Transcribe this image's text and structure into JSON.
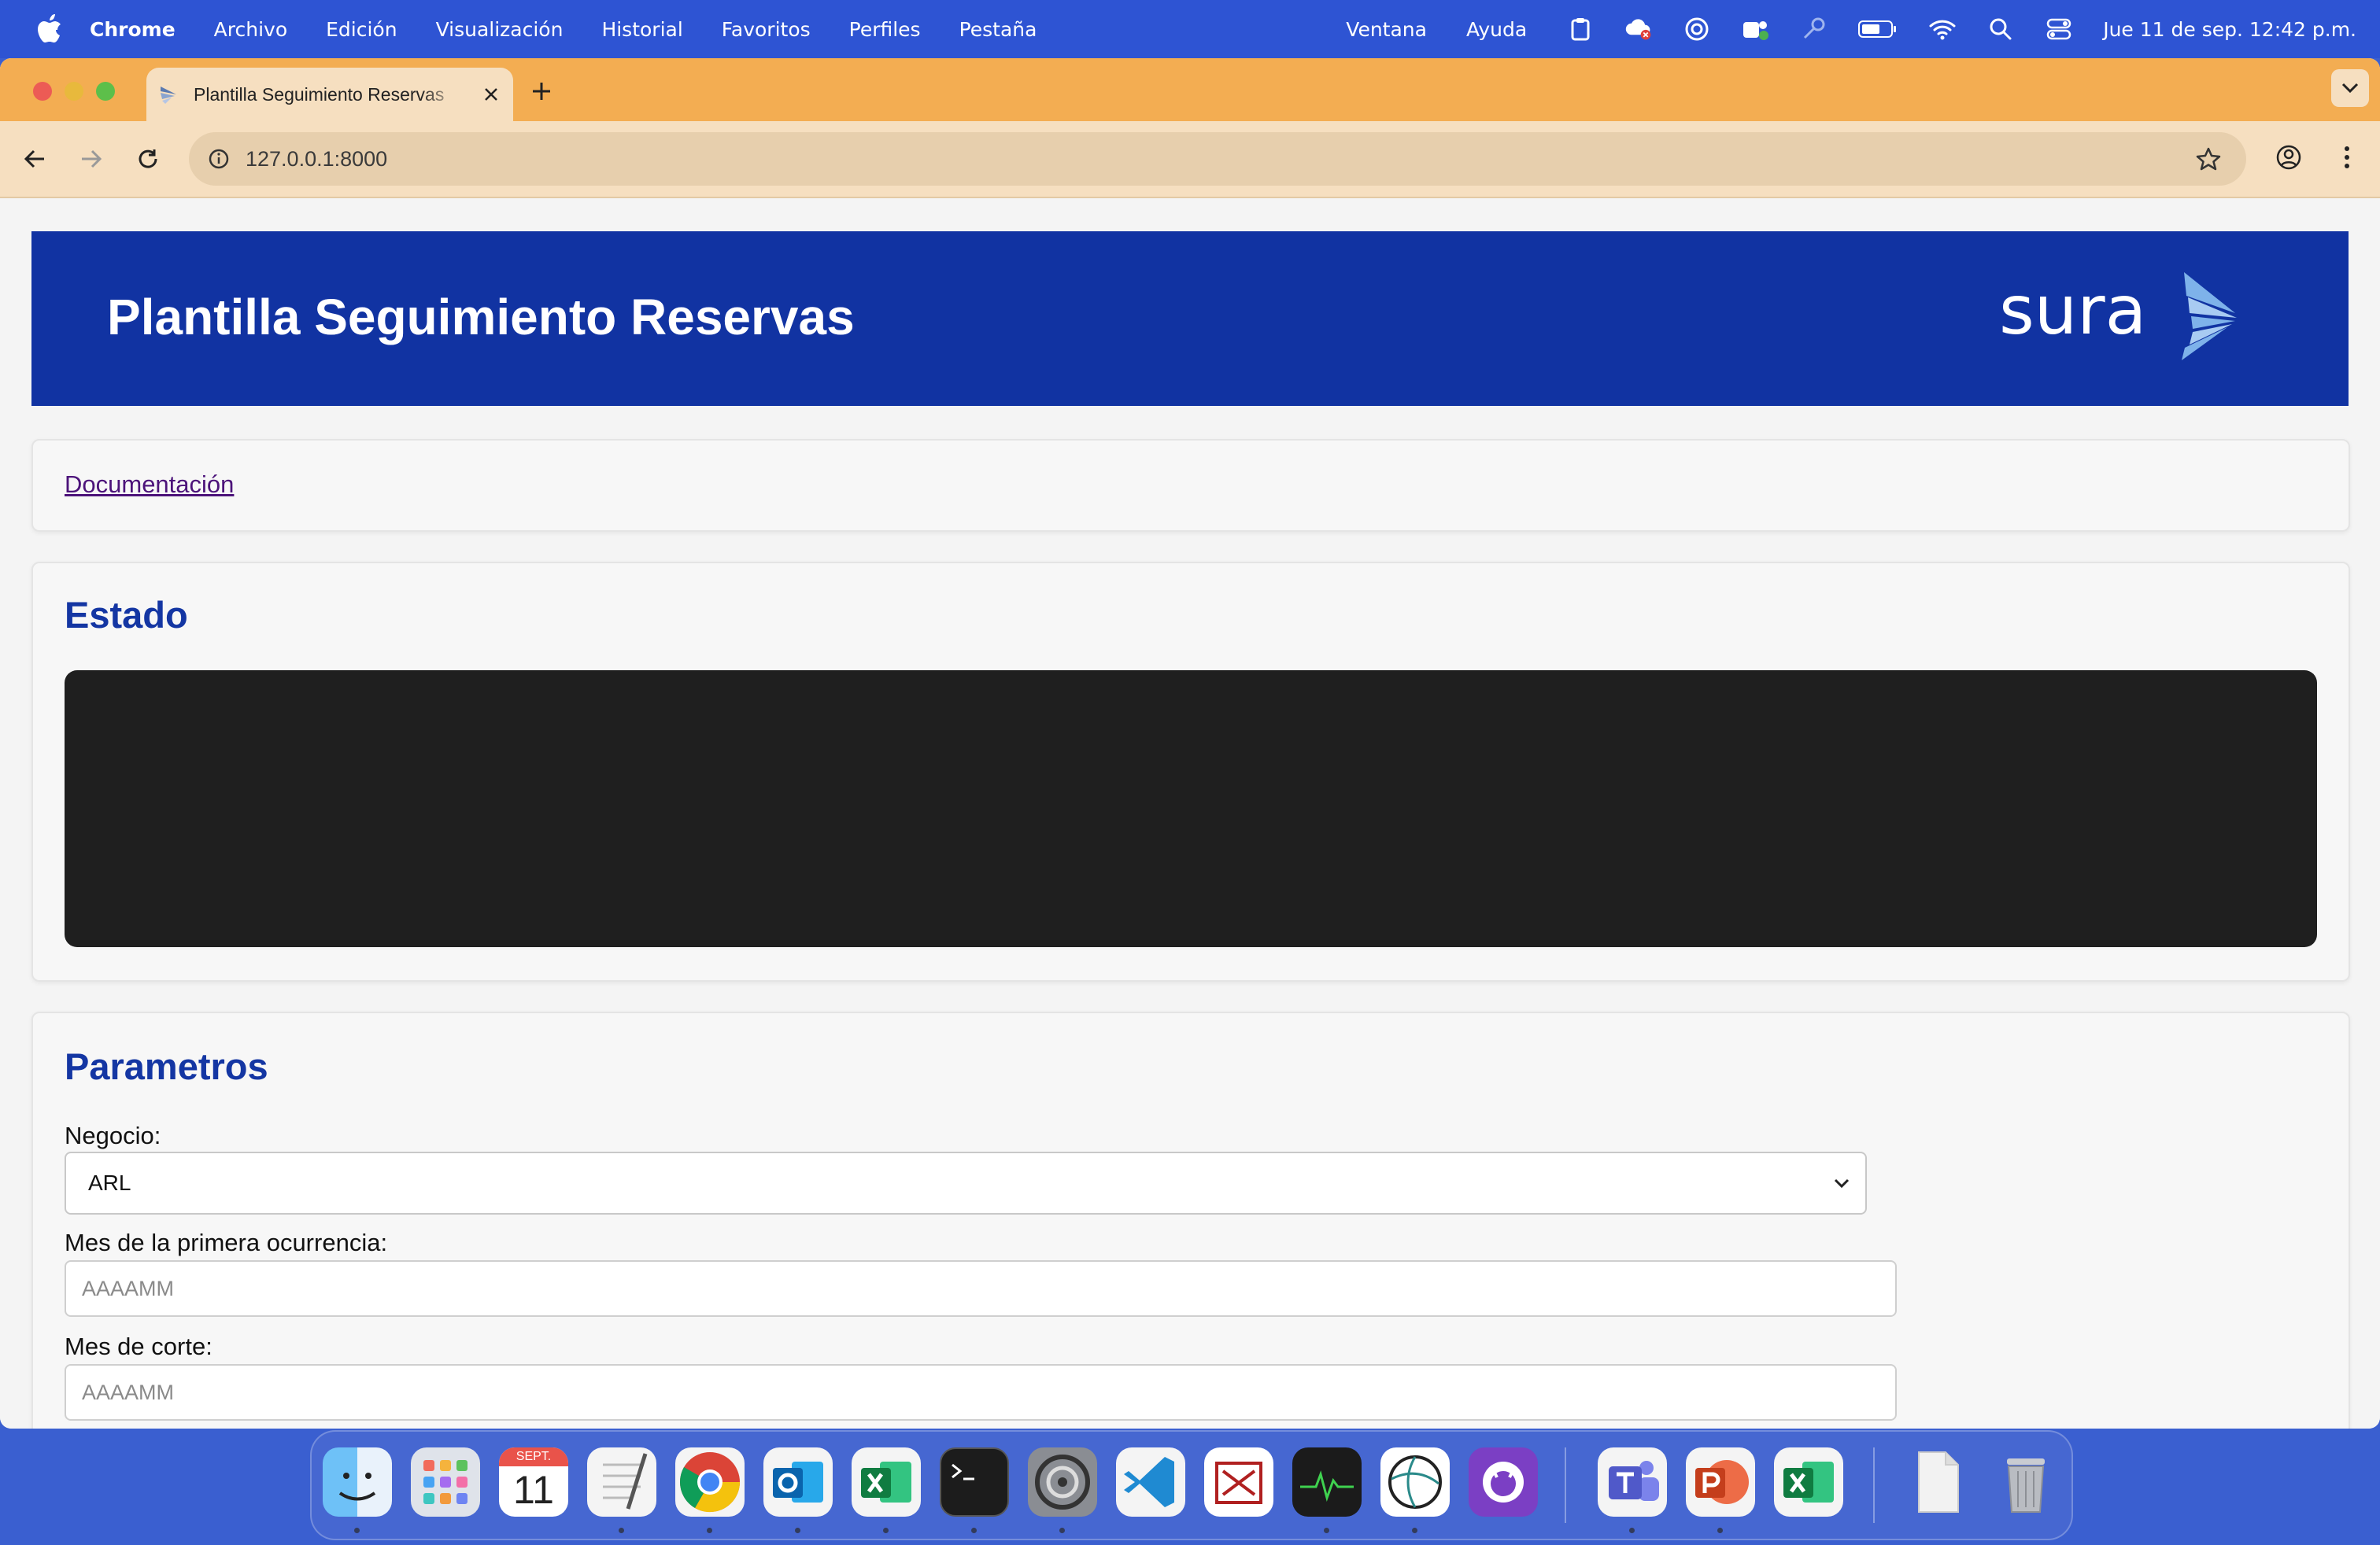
{
  "menubar": {
    "app": "Chrome",
    "items": [
      "Archivo",
      "Edición",
      "Visualización",
      "Historial",
      "Favoritos",
      "Perfiles",
      "Pestaña"
    ],
    "right_items": [
      "Ventana",
      "Ayuda"
    ],
    "clock": "Jue 11 de sep.  12:42 p.m."
  },
  "browser": {
    "tab_title": "Plantilla Seguimiento Reservas",
    "url": "127.0.0.1:8000"
  },
  "page": {
    "banner_title": "Plantilla Seguimiento Reservas",
    "logo_text": "sura",
    "doc_link": "Documentación",
    "estado_title": "Estado",
    "params_title": "Parametros",
    "negocio_label": "Negocio:",
    "negocio_value": "ARL",
    "mes_ocurrencia_label": "Mes de la primera ocurrencia:",
    "mes_ocurrencia_placeholder": "AAAAMM",
    "mes_corte_label": "Mes de corte:",
    "mes_corte_placeholder": "AAAAMM"
  },
  "dock": {
    "calendar_month": "SEPT.",
    "calendar_day": "11",
    "apps": [
      "Finder",
      "Launchpad",
      "Calendar",
      "TextEdit",
      "Chrome",
      "Outlook",
      "Excel",
      "Terminal",
      "System Settings",
      "VS Code",
      "Scrivener",
      "Activity Monitor",
      "Safari-like",
      "GitHub Desktop",
      "Teams",
      "PowerPoint",
      "Excel",
      "Document",
      "Trash"
    ]
  },
  "colors": {
    "banner_bg": "#1133a2",
    "heading": "#1436a3",
    "tabstrip": "#f3ad52",
    "toolbar": "#f6dfc0",
    "console": "#1f1f1f"
  }
}
